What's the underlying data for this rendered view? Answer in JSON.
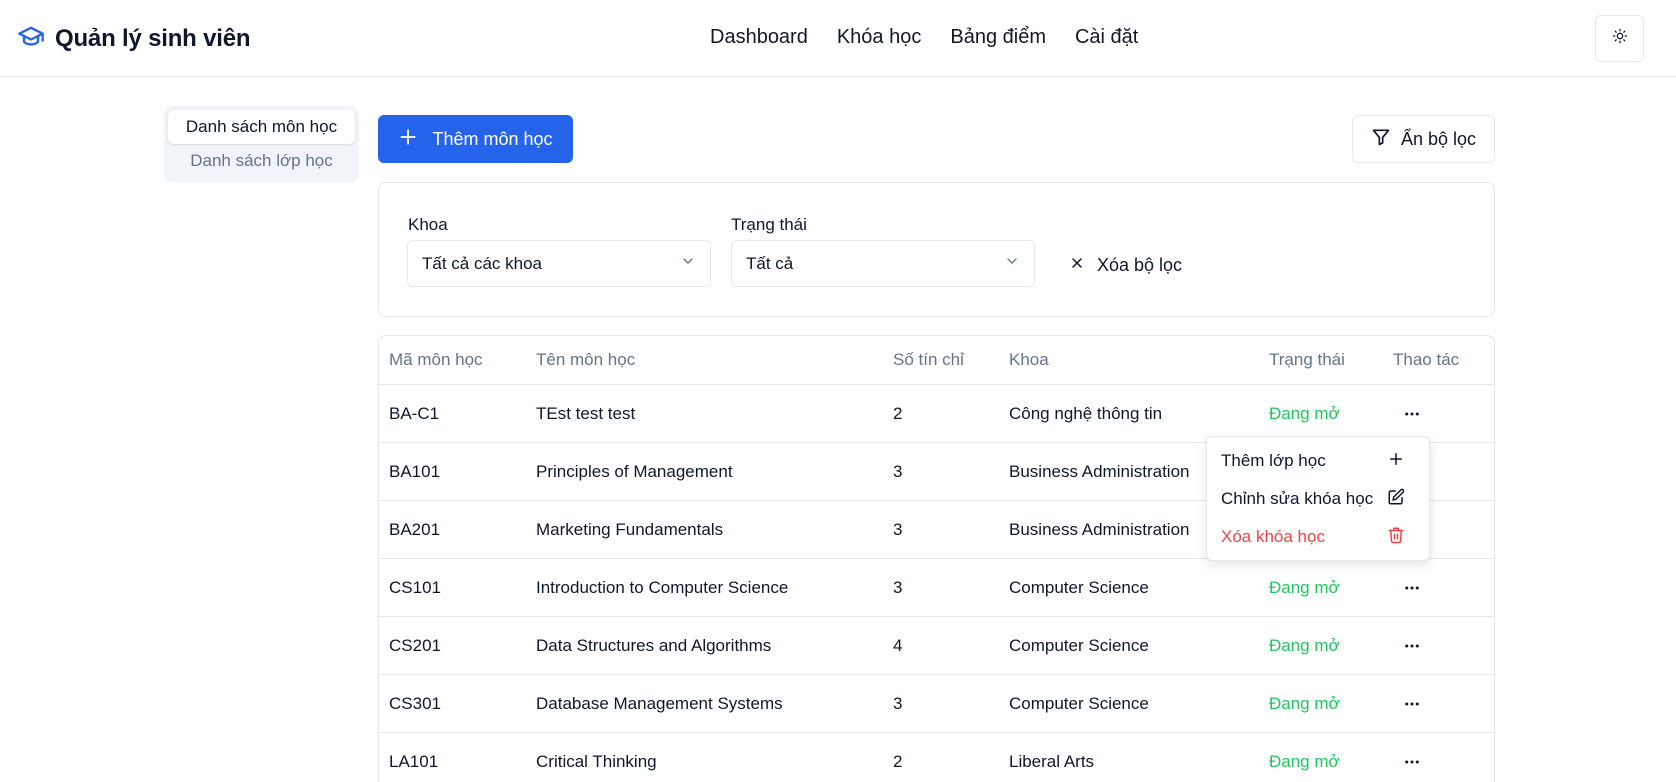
{
  "app": {
    "title": "Quản lý sinh viên"
  },
  "nav": [
    "Dashboard",
    "Khóa học",
    "Bảng điểm",
    "Cài đặt"
  ],
  "side_tabs": [
    {
      "label": "Danh sách môn học",
      "active": true
    },
    {
      "label": "Danh sách lớp học",
      "active": false
    }
  ],
  "toolbar": {
    "add_label": "Thêm môn học",
    "toggle_filter_label": "Ẩn bộ lọc"
  },
  "filters": {
    "faculty_label": "Khoa",
    "faculty_value": "Tất cả các khoa",
    "status_label": "Trạng thái",
    "status_value": "Tất cả",
    "clear_label": "Xóa bộ lọc"
  },
  "table": {
    "columns": [
      "Mã môn học",
      "Tên môn học",
      "Số tín chỉ",
      "Khoa",
      "Trạng thái",
      "Thao tác"
    ],
    "rows": [
      {
        "code": "BA-C1",
        "name": "TEst test test",
        "credits": "2",
        "faculty": "Công nghệ thông tin",
        "status": "Đang mở"
      },
      {
        "code": "BA101",
        "name": "Principles of Management",
        "credits": "3",
        "faculty": "Business Administration",
        "status": ""
      },
      {
        "code": "BA201",
        "name": "Marketing Fundamentals",
        "credits": "3",
        "faculty": "Business Administration",
        "status": ""
      },
      {
        "code": "CS101",
        "name": "Introduction to Computer Science",
        "credits": "3",
        "faculty": "Computer Science",
        "status": "Đang mở"
      },
      {
        "code": "CS201",
        "name": "Data Structures and Algorithms",
        "credits": "4",
        "faculty": "Computer Science",
        "status": "Đang mở"
      },
      {
        "code": "CS301",
        "name": "Database Management Systems",
        "credits": "3",
        "faculty": "Computer Science",
        "status": "Đang mở"
      },
      {
        "code": "LA101",
        "name": "Critical Thinking",
        "credits": "2",
        "faculty": "Liberal Arts",
        "status": "Đang mở"
      }
    ]
  },
  "context_menu": {
    "items": [
      {
        "label": "Thêm lớp học",
        "icon": "plus-icon"
      },
      {
        "label": "Chỉnh sửa khóa học",
        "icon": "edit-icon"
      },
      {
        "label": "Xóa khóa học",
        "icon": "trash-icon"
      }
    ]
  },
  "colors": {
    "primary": "#2563eb",
    "status_open": "#22c55e",
    "danger": "#ef4444"
  }
}
